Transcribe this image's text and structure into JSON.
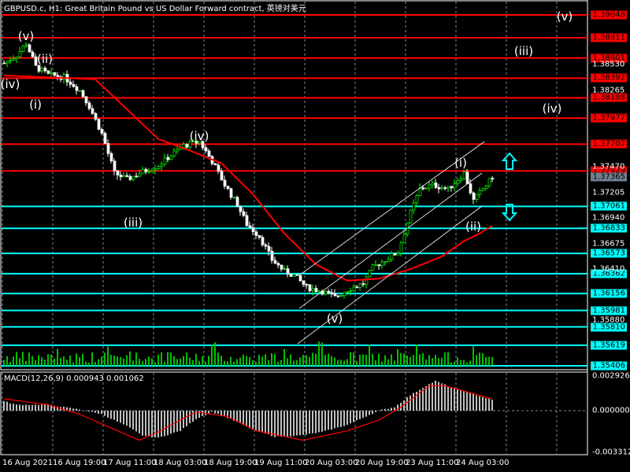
{
  "header": {
    "title": "GBPUSD.c, H1:  Great Britain Pound vs US Dollar Forward contract, 英镑对美元"
  },
  "price_scale": {
    "max": 1.3917,
    "min": 1.3536,
    "ticks": [
      "1.38530",
      "1.38265",
      "1.37470",
      "1.37205",
      "1.36940",
      "1.36675",
      "1.36410",
      "1.35880"
    ],
    "current_price": "1.37365"
  },
  "levels": {
    "red": [
      "1.39048",
      "1.38811",
      "1.38601",
      "1.38392",
      "1.38188",
      "1.37977",
      "1.37707",
      "1.37429"
    ],
    "cyan": [
      "1.37061",
      "1.36833",
      "1.36573",
      "1.36362",
      "1.36156",
      "1.35981",
      "1.35810",
      "1.35619",
      "1.35406"
    ],
    "red_color": "#ff0000",
    "cyan_color": "#00ffff"
  },
  "wave_labels": [
    {
      "text": "(v)",
      "price": 1.3883,
      "bar": 7
    },
    {
      "text": "(ii)",
      "price": 1.3859,
      "bar": 13
    },
    {
      "text": "(iv)",
      "price": 1.3833,
      "bar": 2
    },
    {
      "text": "(i)",
      "price": 1.3812,
      "bar": 10
    },
    {
      "text": "(iv)",
      "price": 1.3779,
      "bar": 62
    },
    {
      "text": "(iii)",
      "price": 1.3689,
      "bar": 41
    },
    {
      "text": "(v)",
      "price": 1.359,
      "bar": 105
    },
    {
      "text": "(i)",
      "price": 1.3751,
      "bar": 145
    },
    {
      "text": "(ii)",
      "price": 1.3685,
      "bar": 149
    },
    {
      "text": "(v)",
      "price": 1.3903,
      "bar": 178
    },
    {
      "text": "(iii)",
      "price": 1.3867,
      "bar": 165
    },
    {
      "text": "(iv)",
      "price": 1.3808,
      "bar": 174
    }
  ],
  "price_waypoints": [
    [
      0,
      1.3855
    ],
    [
      4,
      1.38631
    ],
    [
      7,
      1.38754
    ],
    [
      10,
      1.38509
    ],
    [
      14,
      1.38427
    ],
    [
      19,
      1.38403
    ],
    [
      24,
      1.38264
    ],
    [
      27,
      1.381
    ],
    [
      31,
      1.37814
    ],
    [
      35,
      1.37406
    ],
    [
      39,
      1.37341
    ],
    [
      44,
      1.37422
    ],
    [
      49,
      1.37488
    ],
    [
      52,
      1.37569
    ],
    [
      57,
      1.37692
    ],
    [
      62,
      1.37733
    ],
    [
      66,
      1.37529
    ],
    [
      70,
      1.37283
    ],
    [
      74,
      1.37079
    ],
    [
      77,
      1.36875
    ],
    [
      81,
      1.36752
    ],
    [
      85,
      1.36507
    ],
    [
      89,
      1.36385
    ],
    [
      92,
      1.36344
    ],
    [
      96,
      1.36221
    ],
    [
      101,
      1.3618
    ],
    [
      105,
      1.36115
    ],
    [
      109,
      1.36197
    ],
    [
      114,
      1.36262
    ],
    [
      117,
      1.36425
    ],
    [
      121,
      1.36507
    ],
    [
      125,
      1.36589
    ],
    [
      129,
      1.36997
    ],
    [
      132,
      1.37243
    ],
    [
      136,
      1.37283
    ],
    [
      141,
      1.37243
    ],
    [
      146,
      1.37406
    ],
    [
      149,
      1.3712
    ],
    [
      151,
      1.37202
    ],
    [
      155,
      1.37365
    ]
  ],
  "ma_waypoints": [
    [
      0,
      1.3842
    ],
    [
      29,
      1.3838
    ],
    [
      49,
      1.3776
    ],
    [
      59,
      1.3764
    ],
    [
      69,
      1.3751
    ],
    [
      79,
      1.3719
    ],
    [
      89,
      1.3678
    ],
    [
      99,
      1.3646
    ],
    [
      109,
      1.3629
    ],
    [
      119,
      1.3631
    ],
    [
      129,
      1.3641
    ],
    [
      139,
      1.3654
    ],
    [
      146,
      1.367
    ],
    [
      151,
      1.3678
    ],
    [
      155,
      1.3686
    ]
  ],
  "macd": {
    "label": "MACD(12,26,9) 0.000943 0.001062",
    "max": 0.002926,
    "min": -0.003312,
    "scale_labels": [
      "0.002926",
      "0.000000",
      "-0.003312"
    ],
    "hist_waypoints": [
      [
        0,
        0.0008
      ],
      [
        4,
        0.0005
      ],
      [
        14,
        0.0005
      ],
      [
        24,
        0.0001
      ],
      [
        31,
        -0.0003
      ],
      [
        39,
        -0.0013
      ],
      [
        44,
        -0.0021
      ],
      [
        49,
        -0.0023
      ],
      [
        56,
        -0.0017
      ],
      [
        61,
        -0.0007
      ],
      [
        66,
        -0.0001
      ],
      [
        71,
        -0.0006
      ],
      [
        79,
        -0.0016
      ],
      [
        86,
        -0.0022
      ],
      [
        94,
        -0.0021
      ],
      [
        101,
        -0.0018
      ],
      [
        109,
        -0.0012
      ],
      [
        119,
        0.0
      ],
      [
        124,
        0.0003
      ],
      [
        129,
        0.0013
      ],
      [
        134,
        0.0021
      ],
      [
        137,
        0.0025
      ],
      [
        142,
        0.002
      ],
      [
        149,
        0.0014
      ],
      [
        155,
        0.0009
      ]
    ],
    "signal_waypoints": [
      [
        0,
        0.001
      ],
      [
        14,
        0.0005
      ],
      [
        24,
        -0.0003
      ],
      [
        43,
        -0.0025
      ],
      [
        49,
        -0.0018
      ],
      [
        61,
        -0.0001
      ],
      [
        71,
        -0.0005
      ],
      [
        80,
        -0.0017
      ],
      [
        95,
        -0.0025
      ],
      [
        109,
        -0.0017
      ],
      [
        119,
        -0.0008
      ],
      [
        126,
        0.0003
      ],
      [
        135,
        0.0021
      ],
      [
        140,
        0.0021
      ],
      [
        155,
        0.001
      ]
    ]
  },
  "time_labels": [
    "16 Aug 2021",
    "16 Aug 19:00",
    "17 Aug 11:00",
    "18 Aug 03:00",
    "18 Aug 19:00",
    "19 Aug 11:00",
    "20 Aug 03:00",
    "20 Aug 19:00",
    "23 Aug 11:00",
    "24 Aug 03:00"
  ]
}
